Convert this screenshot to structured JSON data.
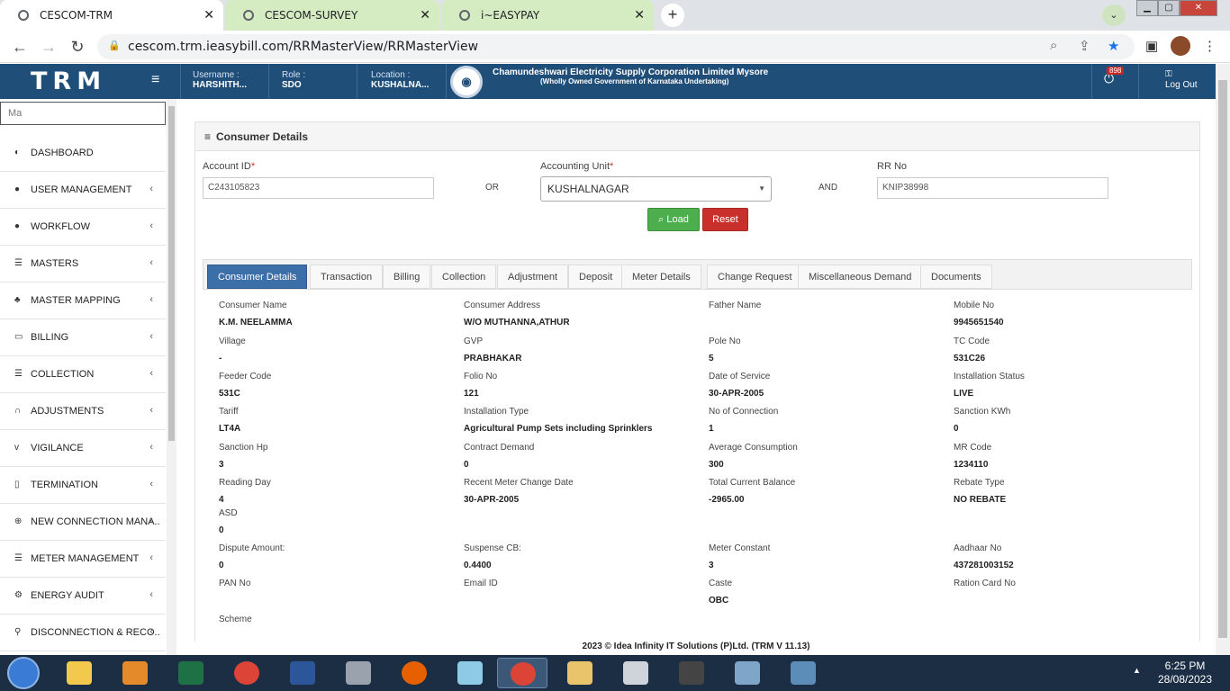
{
  "browser": {
    "tabs": [
      {
        "title": "CESCOM-TRM",
        "active": true
      },
      {
        "title": "CESCOM-SURVEY",
        "active": false
      },
      {
        "title": "i~EASYPAY",
        "active": false
      }
    ],
    "url": "cescom.trm.ieasybill.com/RRMasterView/RRMasterView"
  },
  "header": {
    "logo": "TRM",
    "username_label": "Username :",
    "username": "HARSHITH...",
    "role_label": "Role :",
    "role": "SDO",
    "location_label": "Location :",
    "location": "KUSHALNA...",
    "corp_name": "Chamundeshwari Electricity Supply Corporation Limited Mysore",
    "corp_sub": "(Wholly Owned Government of Karnataka Undertaking)",
    "notification_count": "898",
    "logout": "Log Out"
  },
  "sidebar": {
    "search_value": "Ma",
    "items": [
      {
        "label": "DASHBOARD",
        "icon": "dashboard-icon",
        "has_arrow": false
      },
      {
        "label": "USER MANAGEMENT",
        "icon": "user-icon",
        "has_arrow": true
      },
      {
        "label": "WORKFLOW",
        "icon": "user-icon",
        "has_arrow": true
      },
      {
        "label": "MASTERS",
        "icon": "list-icon",
        "has_arrow": true
      },
      {
        "label": "MASTER MAPPING",
        "icon": "sitemap-icon",
        "has_arrow": true
      },
      {
        "label": "BILLING",
        "icon": "monitor-icon",
        "has_arrow": true
      },
      {
        "label": "COLLECTION",
        "icon": "list-icon",
        "has_arrow": true
      },
      {
        "label": "ADJUSTMENTS",
        "icon": "binoculars-icon",
        "has_arrow": true
      },
      {
        "label": "VIGILANCE",
        "icon": "vk-icon",
        "has_arrow": true
      },
      {
        "label": "TERMINATION",
        "icon": "trash-icon",
        "has_arrow": true
      },
      {
        "label": "NEW CONNECTION MANA..",
        "icon": "plus-circle-icon",
        "has_arrow": true
      },
      {
        "label": "METER MANAGEMENT",
        "icon": "list-icon",
        "has_arrow": true
      },
      {
        "label": "ENERGY AUDIT",
        "icon": "gears-icon",
        "has_arrow": true
      },
      {
        "label": "DISCONNECTION & RECO..",
        "icon": "link-icon",
        "has_arrow": true
      }
    ]
  },
  "form": {
    "panel_title": "Consumer Details",
    "account_id_label": "Account ID",
    "account_id": "C243105823",
    "or_label": "OR",
    "accounting_unit_label": "Accounting Unit",
    "accounting_unit": "KUSHALNAGAR",
    "and_label": "AND",
    "rr_no_label": "RR No",
    "rr_no": "KNIP38998",
    "load_button": "Load",
    "reset_button": "Reset"
  },
  "detail_tabs": [
    "Consumer Details",
    "Transaction",
    "Billing",
    "Collection",
    "Adjustment",
    "Deposit",
    "Meter Details",
    "Change Request",
    "Miscellaneous Demand",
    "Documents"
  ],
  "details": [
    {
      "label": "Consumer Name",
      "value": "K.M. NEELAMMA"
    },
    {
      "label": "Consumer Address",
      "value": "W/O MUTHANNA,ATHUR"
    },
    {
      "label": "Father Name",
      "value": ""
    },
    {
      "label": "Mobile No",
      "value": "9945651540"
    },
    {
      "label": "Village",
      "value": "-"
    },
    {
      "label": "GVP",
      "value": "PRABHAKAR"
    },
    {
      "label": "Pole No",
      "value": "5"
    },
    {
      "label": "TC Code",
      "value": "531C26"
    },
    {
      "label": "Feeder Code",
      "value": "531C"
    },
    {
      "label": "Folio No",
      "value": "121"
    },
    {
      "label": "Date of Service",
      "value": "30-APR-2005"
    },
    {
      "label": "Installation Status",
      "value": "LIVE"
    },
    {
      "label": "Tariff",
      "value": "LT4A"
    },
    {
      "label": "Installation Type",
      "value": "Agricultural Pump Sets including Sprinklers"
    },
    {
      "label": "No of Connection",
      "value": "1"
    },
    {
      "label": "Sanction KWh",
      "value": "0"
    },
    {
      "label": "Sanction Hp",
      "value": "3"
    },
    {
      "label": "Contract Demand",
      "value": "0"
    },
    {
      "label": "Average Consumption",
      "value": "300"
    },
    {
      "label": "MR Code",
      "value": "1234110"
    },
    {
      "label": "Reading Day",
      "value": "4"
    },
    {
      "label": "Recent Meter Change Date",
      "value": "30-APR-2005"
    },
    {
      "label": "Total Current Balance",
      "value": "-2965.00"
    },
    {
      "label": "Rebate Type",
      "value": "NO REBATE"
    },
    {
      "label": "ASD",
      "value": "0"
    },
    {
      "label": "Dispute Amount:",
      "value": "0"
    },
    {
      "label": "Suspense CB:",
      "value": "0.4400"
    },
    {
      "label": "Meter Constant",
      "value": "3"
    },
    {
      "label": "Aadhaar No",
      "value": "437281003152"
    },
    {
      "label": "PAN No",
      "value": ""
    },
    {
      "label": "Email ID",
      "value": ""
    },
    {
      "label": "Caste",
      "value": "OBC"
    },
    {
      "label": "Ration Card No",
      "value": ""
    },
    {
      "label": "Scheme",
      "value": ""
    }
  ],
  "footer": "2023 © Idea Infinity IT Solutions (P)Ltd. (TRM V 11.13)",
  "taskbar": {
    "time": "6:25 PM",
    "date": "28/08/2023"
  },
  "colors": {
    "header_bg": "#1f4e79",
    "active_tab": "#3c6ea8",
    "load_green": "#4cae4c",
    "reset_red": "#c9302c"
  }
}
